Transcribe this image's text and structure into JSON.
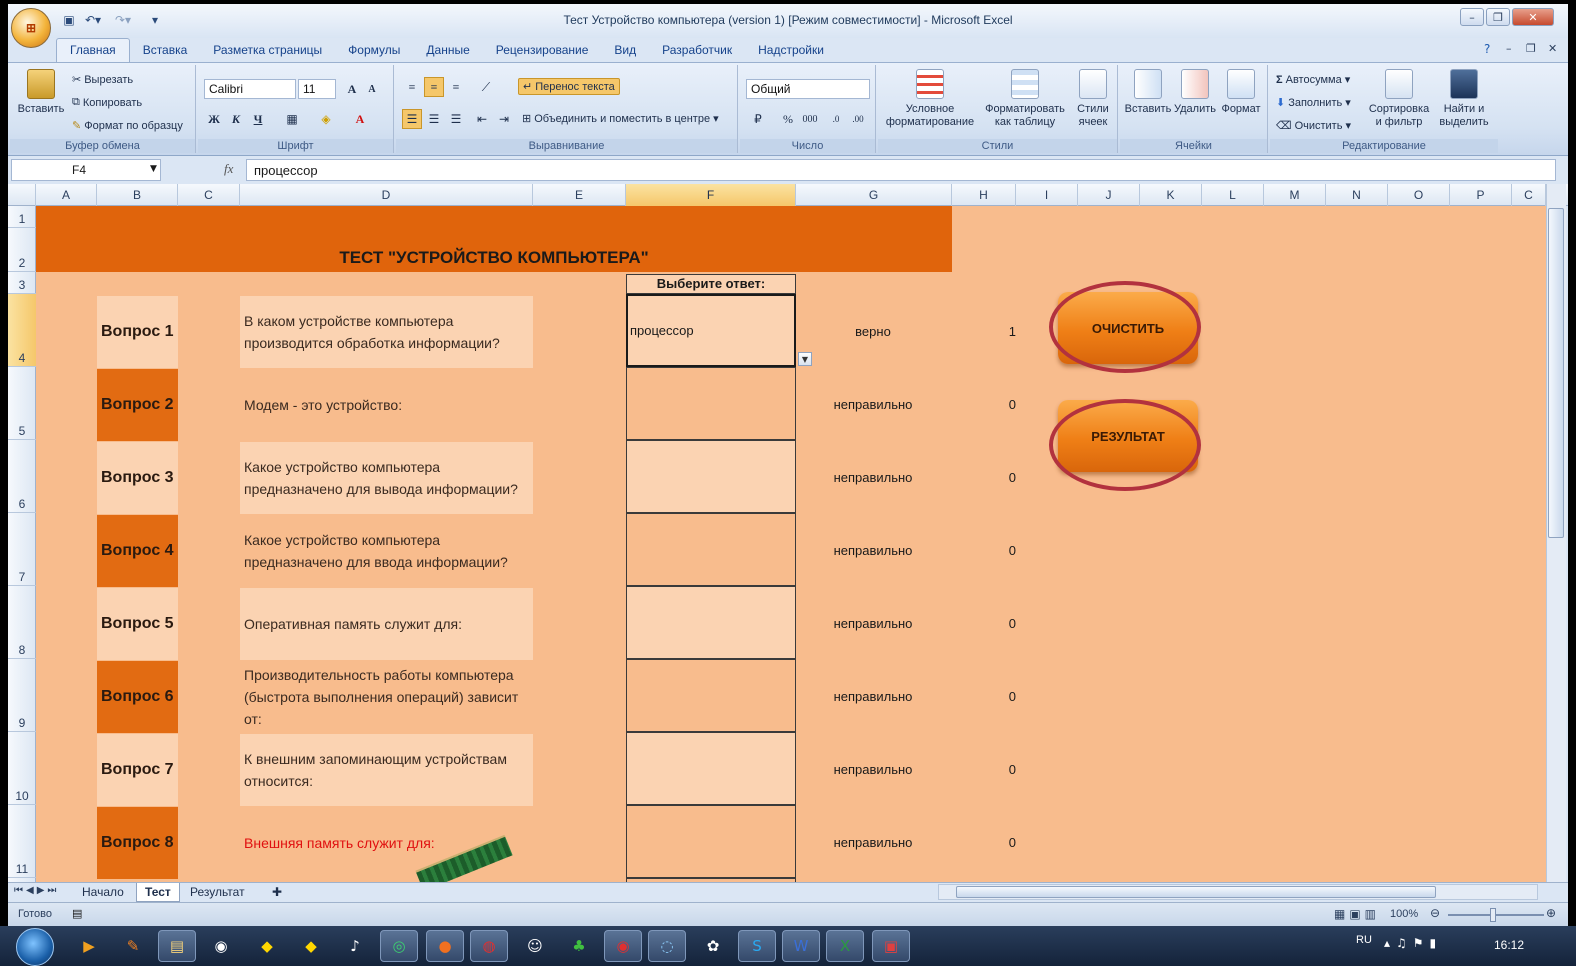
{
  "window": {
    "title": "Тест Устройство компьютера (version 1)  [Режим совместимости] - Microsoft Excel",
    "office_button": "Office"
  },
  "ribbon_tabs": [
    "Главная",
    "Вставка",
    "Разметка страницы",
    "Формулы",
    "Данные",
    "Рецензирование",
    "Вид",
    "Разработчик",
    "Надстройки"
  ],
  "clipboard": {
    "paste": "Вставить",
    "cut": "Вырезать",
    "copy": "Копировать",
    "format_painter": "Формат по образцу",
    "group": "Буфер обмена"
  },
  "font": {
    "name": "Calibri",
    "size": "11",
    "bold": "Ж",
    "italic": "К",
    "underline": "Ч",
    "group": "Шрифт"
  },
  "alignment": {
    "wrap": "Перенос текста",
    "merge": "Объединить и поместить в центре",
    "group": "Выравнивание"
  },
  "number": {
    "format": "Общий",
    "percent": "%",
    "thousands": "000",
    "group": "Число"
  },
  "styles": {
    "conditional": "Условное форматирование",
    "as_table": "Форматировать как таблицу",
    "cell_styles": "Стили ячеек",
    "group": "Стили"
  },
  "cells": {
    "insert": "Вставить",
    "delete": "Удалить",
    "format": "Формат",
    "group": "Ячейки"
  },
  "editing": {
    "autosum": "Автосумма",
    "fill": "Заполнить",
    "clear": "Очистить",
    "sort": "Сортировка и фильтр",
    "find": "Найти и выделить",
    "group": "Редактирование"
  },
  "formula_bar": {
    "cell_ref": "F4",
    "fx": "fx",
    "value": "процессор"
  },
  "columns": [
    "A",
    "B",
    "C",
    "D",
    "E",
    "F",
    "G",
    "H",
    "I",
    "J",
    "K",
    "L",
    "M",
    "N",
    "O",
    "P",
    "C"
  ],
  "rows": [
    "1",
    "2",
    "3",
    "4",
    "5",
    "6",
    "7",
    "8",
    "9",
    "10",
    "11"
  ],
  "sheet": {
    "banner": "ТЕСТ \"УСТРОЙСТВО КОМПЬЮТЕРА\"",
    "answer_header": "Выберите ответ:",
    "questions": [
      {
        "label": "Вопрос 1",
        "text": "В каком устройстве компьютера производится обработка информации?",
        "answer": "процессор",
        "result": "верно",
        "score": "1"
      },
      {
        "label": "Вопрос 2",
        "text": "Модем - это устройство:",
        "answer": "",
        "result": "неправильно",
        "score": "0"
      },
      {
        "label": "Вопрос 3",
        "text": "Какое устройство компьютера предназначено для вывода информации?",
        "answer": "",
        "result": "неправильно",
        "score": "0"
      },
      {
        "label": "Вопрос 4",
        "text": "Какое устройство компьютера предназначено для ввода информации?",
        "answer": "",
        "result": "неправильно",
        "score": "0"
      },
      {
        "label": "Вопрос 5",
        "text": "Оперативная память служит для:",
        "answer": "",
        "result": "неправильно",
        "score": "0"
      },
      {
        "label": "Вопрос 6",
        "text": "Производительность работы компьютера (быстрота выполнения операций) зависит от:",
        "answer": "",
        "result": "неправильно",
        "score": "0"
      },
      {
        "label": "Вопрос 7",
        "text": "К внешним запоминающим устройствам относится:",
        "answer": "",
        "result": "неправильно",
        "score": "0"
      },
      {
        "label": "Вопрос 8",
        "text": "Внешняя память служит для:",
        "answer": "",
        "result": "неправильно",
        "score": "0"
      }
    ],
    "btn_clear": "ОЧИСТИТЬ",
    "btn_result": "РЕЗУЛЬТАТ"
  },
  "sheet_tabs": [
    "Начало",
    "Тест",
    "Результат"
  ],
  "status": {
    "ready": "Готово",
    "zoom": "100%"
  },
  "taskbar": {
    "lang": "RU",
    "clock": "16:12"
  },
  "colors": {
    "banner": "#e0640c",
    "sheet_bg": "#f8bc8d",
    "light_cell": "#fbd3b2",
    "button": "#ef7f16",
    "ring": "#b2323e"
  }
}
